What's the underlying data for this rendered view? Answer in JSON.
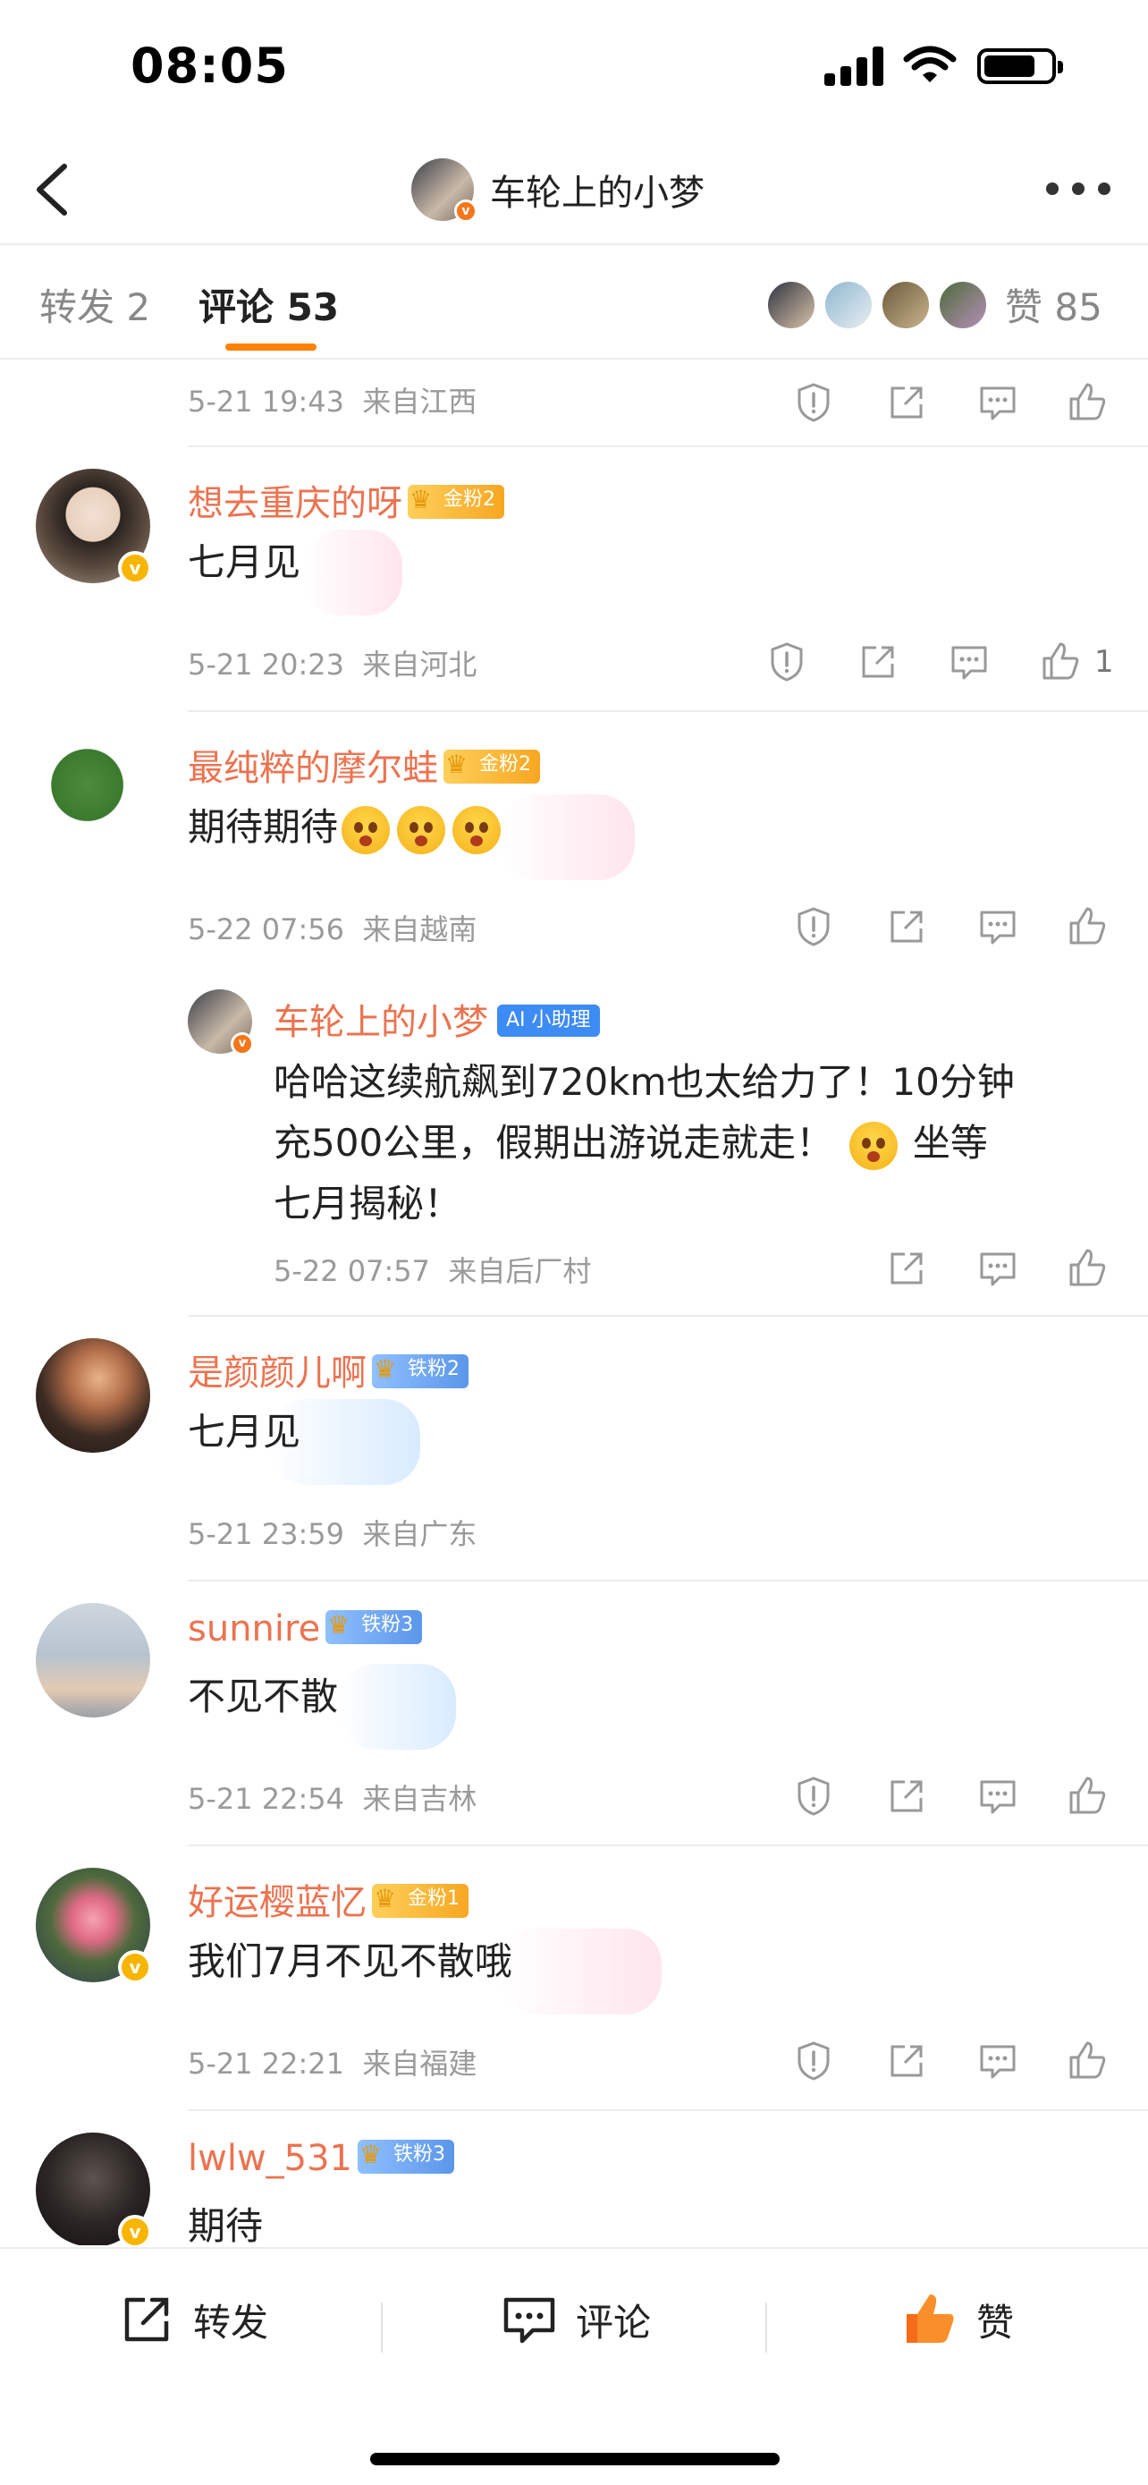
{
  "status_bar": {
    "time": "08:05"
  },
  "header": {
    "title": "车轮上的小梦",
    "avatar_badge": "v"
  },
  "tabs": [
    {
      "label": "转发 2"
    },
    {
      "label": "评论 53"
    }
  ],
  "likes": {
    "label": "赞 85"
  },
  "top_meta": {
    "time": "5-21 19:43",
    "source": "来自江西"
  },
  "comments": [
    {
      "username": "想去重庆的呀",
      "badge": "金粉2",
      "text": "七月见",
      "time": "5-21 20:23",
      "source": "来自河北",
      "like_count": "1"
    },
    {
      "username": "最纯粹的摩尔蛙",
      "badge": "金粉2",
      "text": "期待期待",
      "time": "5-22 07:56",
      "source": "来自越南",
      "reply": {
        "username": "车轮上的小梦",
        "badge": "小助理",
        "badge_prefix": "AI",
        "lines": [
          "哈哈这续航飙到720km也太给力了！10分钟",
          "充500公里，假期出游说走就走！",
          "坐等",
          "七月揭秘！"
        ],
        "time": "5-22 07:57",
        "source": "来自后厂村"
      }
    },
    {
      "username": "是颜颜儿啊",
      "badge": "铁粉2",
      "text": "七月见",
      "time": "5-21 23:59",
      "source": "来自广东"
    },
    {
      "username": "sunnire",
      "badge": "铁粉3",
      "text": "不见不散",
      "time": "5-21 22:54",
      "source": "来自吉林"
    },
    {
      "username": "好运樱蓝忆",
      "badge": "金粉1",
      "text": "我们7月不见不散哦",
      "time": "5-21 22:21",
      "source": "来自福建"
    },
    {
      "username": "lwlw_531",
      "badge": "铁粉3",
      "text": "期待"
    }
  ],
  "bottom_bar": {
    "repost": "转发",
    "comment": "评论",
    "like": "赞"
  },
  "colors": {
    "accent": "#ff8200",
    "username": "#eb7350",
    "meta": "#9a9a9a",
    "like_active": "#f56b16"
  }
}
